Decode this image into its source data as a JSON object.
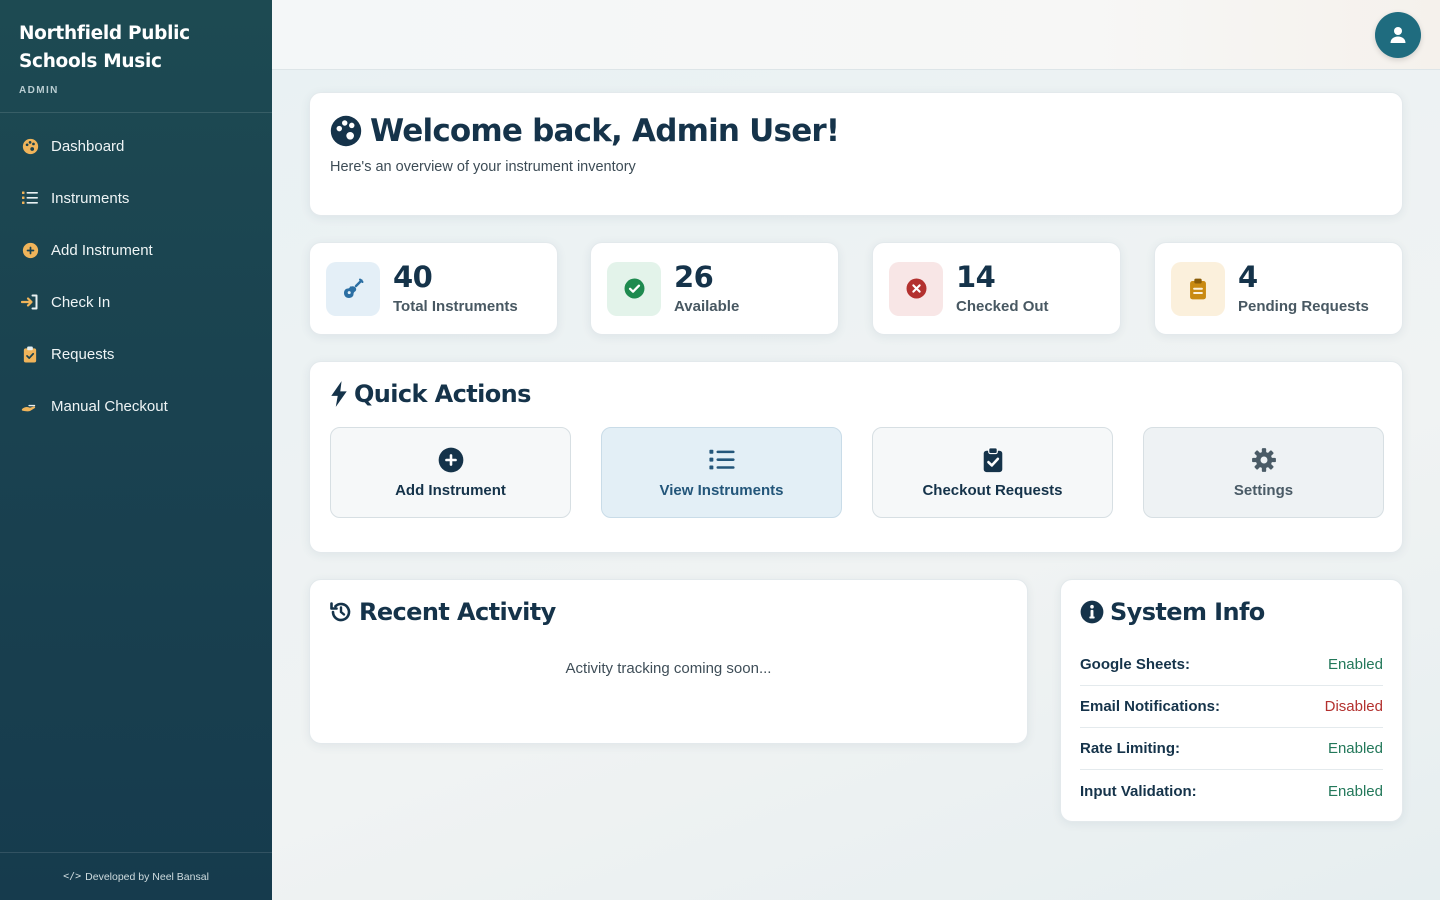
{
  "sidebar": {
    "brand_title": "Northfield Public Schools Music",
    "role": "ADMIN",
    "items": [
      {
        "label": "Dashboard",
        "icon": "palette-icon"
      },
      {
        "label": "Instruments",
        "icon": "list-icon"
      },
      {
        "label": "Add Instrument",
        "icon": "plus-circle-icon"
      },
      {
        "label": "Check In",
        "icon": "sign-in-icon"
      },
      {
        "label": "Requests",
        "icon": "clipboard-check-icon"
      },
      {
        "label": "Manual Checkout",
        "icon": "hand-holding-icon"
      }
    ],
    "footer_code": "</>",
    "footer_text": "Developed by Neel Bansal",
    "accent_icon_color": "#f0b45a"
  },
  "header": {
    "avatar_icon": "user-icon"
  },
  "welcome": {
    "title": "Welcome back, Admin User!",
    "subtitle": "Here's an overview of your instrument inventory",
    "icon": "palette-icon"
  },
  "stats": [
    {
      "value": "40",
      "label": "Total Instruments",
      "icon": "guitar-icon",
      "color": "#2c6fa3"
    },
    {
      "value": "26",
      "label": "Available",
      "icon": "check-circle-icon",
      "color": "#1e8a4f"
    },
    {
      "value": "14",
      "label": "Checked Out",
      "icon": "times-circle-icon",
      "color": "#b3312f"
    },
    {
      "value": "4",
      "label": "Pending Requests",
      "icon": "clipboard-icon",
      "color": "#c98a12"
    }
  ],
  "quick_actions": {
    "title": "Quick Actions",
    "icon": "bolt-icon",
    "buttons": [
      {
        "label": "Add Instrument",
        "icon": "plus-circle-icon"
      },
      {
        "label": "View Instruments",
        "icon": "list-icon"
      },
      {
        "label": "Checkout Requests",
        "icon": "clipboard-check-icon"
      },
      {
        "label": "Settings",
        "icon": "gear-icon"
      }
    ]
  },
  "recent_activity": {
    "title": "Recent Activity",
    "icon": "history-icon",
    "empty_text": "Activity tracking coming soon..."
  },
  "system_info": {
    "title": "System Info",
    "icon": "info-circle-icon",
    "rows": [
      {
        "key": "Google Sheets:",
        "value": "Enabled",
        "status": "enabled"
      },
      {
        "key": "Email Notifications:",
        "value": "Disabled",
        "status": "disabled"
      },
      {
        "key": "Rate Limiting:",
        "value": "Enabled",
        "status": "enabled"
      },
      {
        "key": "Input Validation:",
        "value": "Enabled",
        "status": "enabled"
      }
    ]
  }
}
